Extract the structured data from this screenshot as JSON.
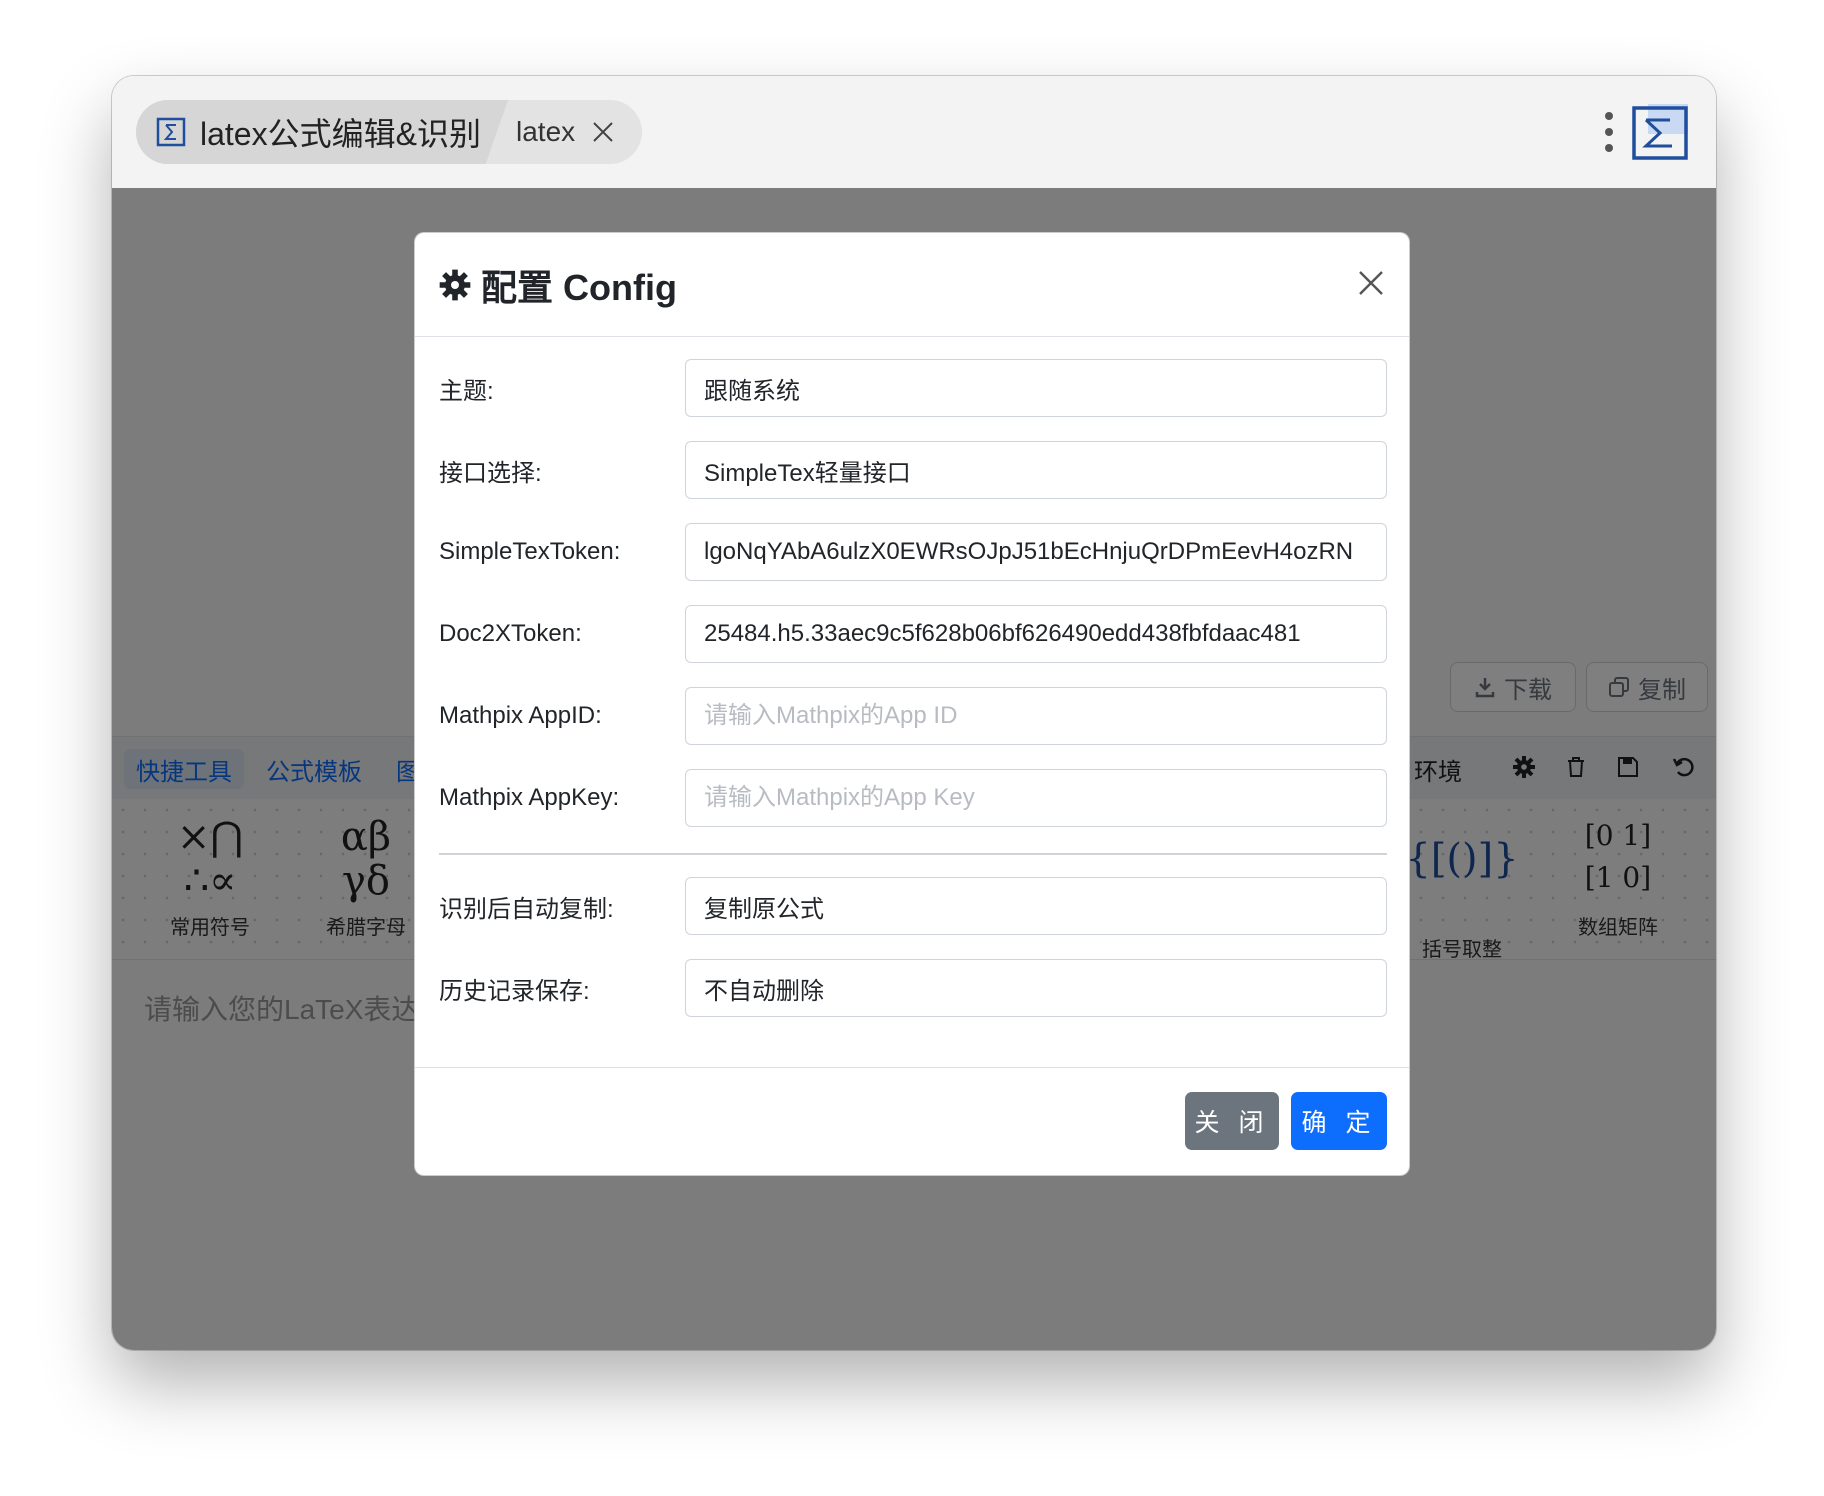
{
  "window": {
    "tab_title": "latex公式编辑&识别",
    "second_tab_label": "latex"
  },
  "background": {
    "download_label": "下载",
    "copy_label": "复制",
    "toolbar_tabs": [
      "快捷工具",
      "公式模板",
      "图"
    ],
    "env_label": "环境",
    "symbol_groups": [
      {
        "glyph_top": "×⋂",
        "glyph_bottom": "∴∝",
        "label": "常用符号"
      },
      {
        "glyph_top": "αβ",
        "glyph_bottom": "γδ",
        "label": "希腊字母"
      },
      {
        "glyph_top": "{[()]}",
        "glyph_bottom": "",
        "label": "括号取整"
      },
      {
        "glyph_top": "[0  1]",
        "glyph_bottom": "[1  0]",
        "label": "数组矩阵"
      }
    ],
    "editor_placeholder": "请输入您的LaTeX表达"
  },
  "modal": {
    "title": "配置 Config",
    "fields": [
      {
        "label": "主题:",
        "value": "跟随系统",
        "placeholder": ""
      },
      {
        "label": "接口选择:",
        "value": "SimpleTex轻量接口",
        "placeholder": ""
      },
      {
        "label": "SimpleTexToken:",
        "value": "lgoNqYAbA6ulzX0EWRsOJpJ51bEcHnjuQrDPmEevH4ozRN",
        "placeholder": ""
      },
      {
        "label": "Doc2XToken:",
        "value": "25484.h5.33aec9c5f628b06bf626490edd438fbfdaac481",
        "placeholder": ""
      },
      {
        "label": "Mathpix AppID:",
        "value": "",
        "placeholder": "请输入Mathpix的App ID"
      },
      {
        "label": "Mathpix AppKey:",
        "value": "",
        "placeholder": "请输入Mathpix的App Key"
      }
    ],
    "extra_fields": [
      {
        "label": "识别后自动复制:",
        "value": "复制原公式"
      },
      {
        "label": "历史记录保存:",
        "value": "不自动删除"
      }
    ],
    "close_button": "关 闭",
    "confirm_button": "确 定"
  },
  "colors": {
    "primary": "#0d6efd",
    "secondary": "#6c757d",
    "logo": "#1f4e9c"
  }
}
